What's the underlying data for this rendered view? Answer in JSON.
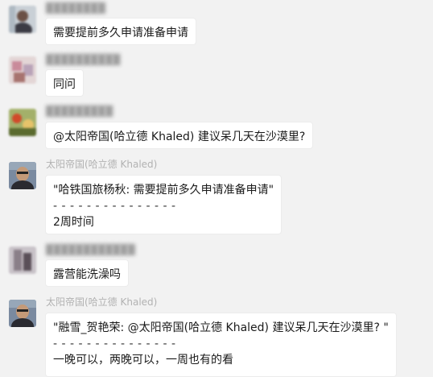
{
  "messages": [
    {
      "sender": "",
      "lines": [
        "需要提前多久申请准备申请"
      ]
    },
    {
      "sender": "",
      "lines": [
        "同问"
      ]
    },
    {
      "sender": "",
      "lines": [
        "@太阳帝国(哈立德 Khaled) 建议呆几天在沙漠里?"
      ]
    },
    {
      "sender": "太阳帝国(哈立德 Khaled)",
      "lines": [
        "\"哈铁国旅杨秋: 需要提前多久申请准备申请\"",
        "- - - - - - - - - - - - - - -",
        "2周时间"
      ]
    },
    {
      "sender": "",
      "lines": [
        "露营能洗澡吗"
      ]
    },
    {
      "sender": "太阳帝国(哈立德 Khaled)",
      "lines": [
        "\"融雪_贺艳荣: @太阳帝国(哈立德 Khaled) 建议呆几天在沙漠里? \"",
        "- - - - - - - - - - - - - - -",
        "一晚可以，两晚可以，一周也有的看"
      ]
    }
  ],
  "colors": {
    "background": "#f2f2f2",
    "bubble": "#ffffff",
    "sender_text": "#b2b2b2",
    "message_text": "#1a1a1a"
  }
}
